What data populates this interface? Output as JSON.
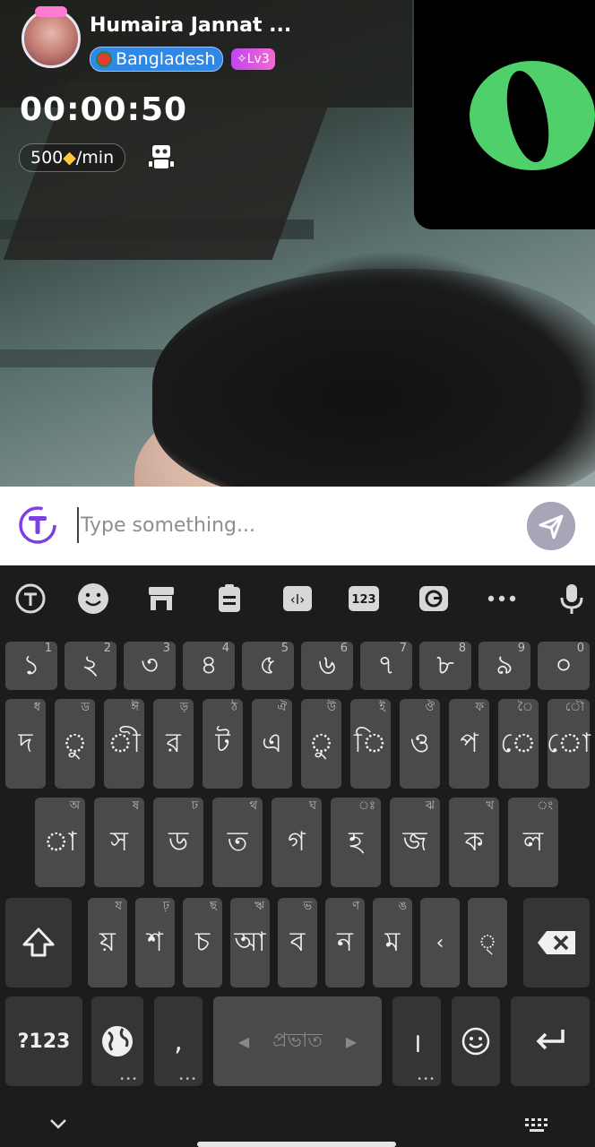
{
  "caller": {
    "name": "Humaira Jannat ...",
    "country": "Bangladesh",
    "level": "Lv3"
  },
  "call": {
    "timer": "00:00:50",
    "rate_value": "500",
    "rate_unit": "/min"
  },
  "message": {
    "placeholder": "Type something..."
  },
  "keyboard": {
    "number_row": [
      {
        "label": "১",
        "hint": "1"
      },
      {
        "label": "২",
        "hint": "2"
      },
      {
        "label": "৩",
        "hint": "3"
      },
      {
        "label": "৪",
        "hint": "4"
      },
      {
        "label": "৫",
        "hint": "5"
      },
      {
        "label": "৬",
        "hint": "6"
      },
      {
        "label": "৭",
        "hint": "7"
      },
      {
        "label": "৮",
        "hint": "8"
      },
      {
        "label": "৯",
        "hint": "9"
      },
      {
        "label": "০",
        "hint": "0"
      }
    ],
    "row1": [
      {
        "label": "দ",
        "hint": "ধ"
      },
      {
        "label": "ু",
        "hint": "ড"
      },
      {
        "label": "ী",
        "hint": "ঈ"
      },
      {
        "label": "র",
        "hint": "ড়"
      },
      {
        "label": "ট",
        "hint": "ঠ"
      },
      {
        "label": "এ",
        "hint": "ঐ"
      },
      {
        "label": "ু",
        "hint": "উ"
      },
      {
        "label": "ি",
        "hint": "ই"
      },
      {
        "label": "ও",
        "hint": "ঔ"
      },
      {
        "label": "প",
        "hint": "ফ"
      },
      {
        "label": "ে",
        "hint": "ৈ"
      },
      {
        "label": "ো",
        "hint": "ৌ"
      }
    ],
    "row2": [
      {
        "label": "া",
        "hint": "অ"
      },
      {
        "label": "স",
        "hint": "ষ"
      },
      {
        "label": "ড",
        "hint": "ঢ"
      },
      {
        "label": "ত",
        "hint": "থ"
      },
      {
        "label": "গ",
        "hint": "ঘ"
      },
      {
        "label": "হ",
        "hint": "ঃ"
      },
      {
        "label": "জ",
        "hint": "ঝ"
      },
      {
        "label": "ক",
        "hint": "খ"
      },
      {
        "label": "ল",
        "hint": "ং"
      }
    ],
    "row3": [
      {
        "label": "য়",
        "hint": "য"
      },
      {
        "label": "শ",
        "hint": "ঢ়"
      },
      {
        "label": "চ",
        "hint": "ছ"
      },
      {
        "label": "আ",
        "hint": "ঋ"
      },
      {
        "label": "ব",
        "hint": "ভ"
      },
      {
        "label": "ন",
        "hint": "ণ"
      },
      {
        "label": "ম",
        "hint": "ঙ"
      },
      {
        "label": "‹",
        "hint": ""
      },
      {
        "label": "্",
        "hint": ""
      }
    ],
    "symbols_label": "?123",
    "comma": ",",
    "space_label": "প্রভাত",
    "danda": "।"
  }
}
